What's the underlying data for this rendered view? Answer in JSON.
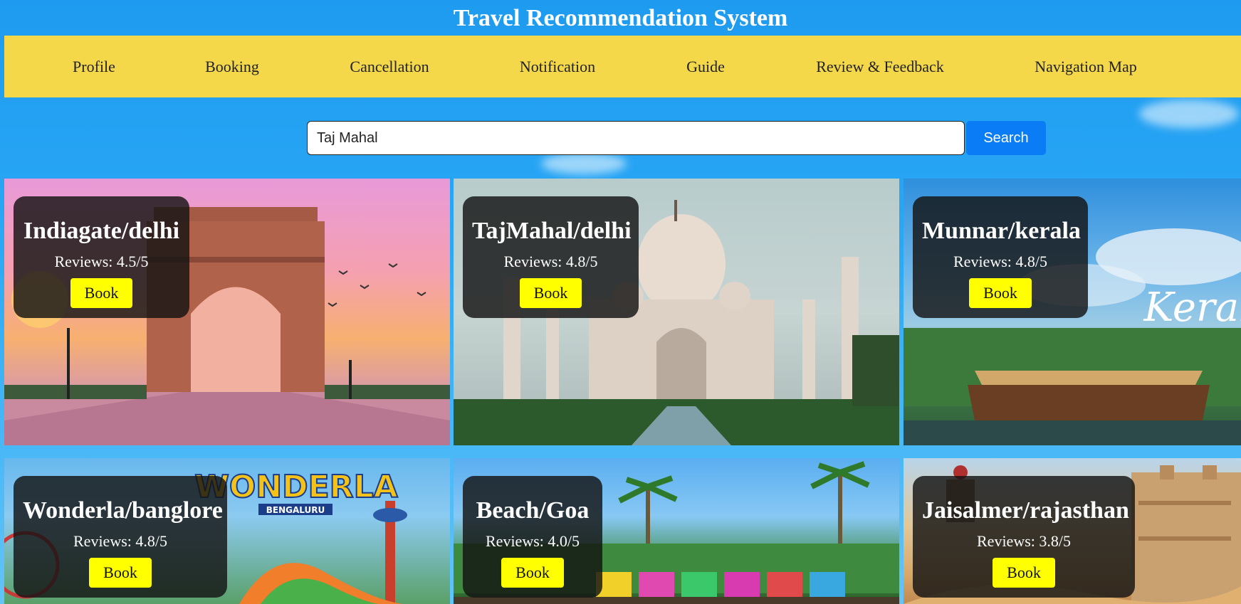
{
  "app": {
    "title": "Travel Recommendation System"
  },
  "nav": {
    "items": [
      {
        "id": "profile",
        "label": "Profile"
      },
      {
        "id": "booking",
        "label": "Booking"
      },
      {
        "id": "cancellation",
        "label": "Cancellation"
      },
      {
        "id": "notification",
        "label": "Notification"
      },
      {
        "id": "guide",
        "label": "Guide"
      },
      {
        "id": "review-feedback",
        "label": "Review & Feedback"
      },
      {
        "id": "navigation-map",
        "label": "Navigation Map"
      }
    ]
  },
  "search": {
    "value": "Taj Mahal",
    "button_label": "Search"
  },
  "destinations": [
    {
      "name": "Indiagate/delhi",
      "reviews": "Reviews: 4.5/5",
      "book_label": "Book"
    },
    {
      "name": "TajMahal/delhi",
      "reviews": "Reviews: 4.8/5",
      "book_label": "Book"
    },
    {
      "name": "Munnar/kerala",
      "reviews": "Reviews: 4.8/5",
      "book_label": "Book",
      "image_text": "Kerala"
    },
    {
      "name": "Wonderla/banglore",
      "reviews": "Reviews: 4.8/5",
      "book_label": "Book",
      "image_text": "WONDERLA",
      "image_subtext": "BENGALURU"
    },
    {
      "name": "Beach/Goa",
      "reviews": "Reviews: 4.0/5",
      "book_label": "Book"
    },
    {
      "name": "Jaisalmer/rajasthan",
      "reviews": "Reviews: 3.8/5",
      "book_label": "Book"
    }
  ],
  "colors": {
    "nav_bg": "#f4d84a",
    "search_button": "#0a7cf6",
    "book_button": "#ffff00",
    "overlay": "#141414"
  }
}
